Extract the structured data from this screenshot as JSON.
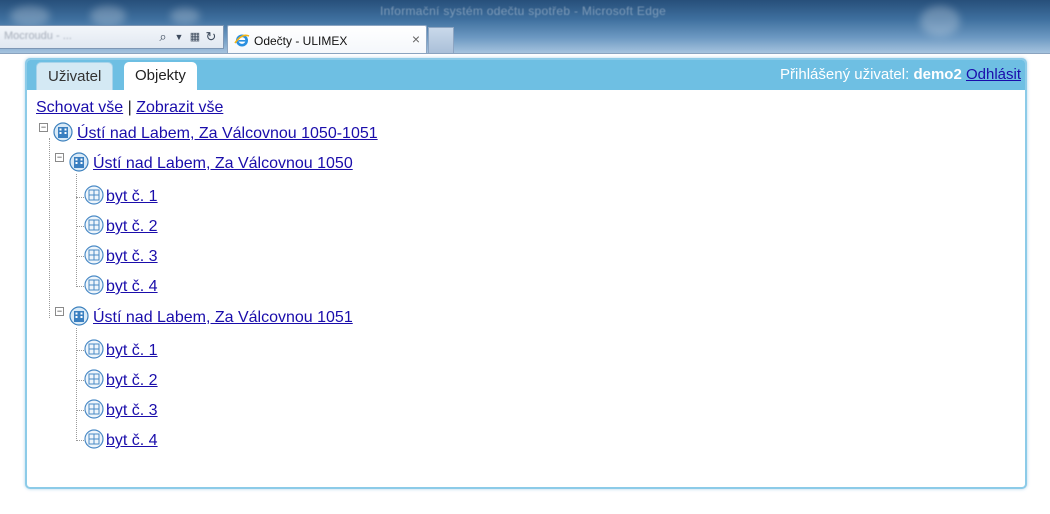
{
  "browser": {
    "window_title": "Informační systém odečtu spotřeb - Microsoft Edge",
    "address_text": "Mocroudu - ...",
    "tab_title": "Odečty - ULIMEX",
    "tab_close": "×"
  },
  "tabs": [
    {
      "label": "Uživatel",
      "active": false
    },
    {
      "label": "Objekty",
      "active": true
    }
  ],
  "user": {
    "prefix": "Přihlášený uživatel: ",
    "name": "demo2",
    "logout": "Odhlásit"
  },
  "controls": {
    "hide_all": "Schovat vše",
    "separator": " | ",
    "show_all": "Zobrazit vše"
  },
  "tree": {
    "root": {
      "label": "Ústí nad Labem, Za Válcovnou 1050-1051",
      "expanded": true,
      "children": [
        {
          "label": "Ústí nad Labem, Za Válcovnou 1050",
          "expanded": true,
          "children": [
            {
              "label": "byt č. 1"
            },
            {
              "label": "byt č. 2"
            },
            {
              "label": "byt č. 3"
            },
            {
              "label": "byt č. 4"
            }
          ]
        },
        {
          "label": "Ústí nad Labem, Za Válcovnou 1051",
          "expanded": true,
          "children": [
            {
              "label": "byt č. 1"
            },
            {
              "label": "byt č. 2"
            },
            {
              "label": "byt č. 3"
            },
            {
              "label": "byt č. 4"
            }
          ]
        }
      ]
    }
  },
  "icons": {
    "toggle": "minus-icon",
    "building": "building-icon",
    "apartment": "apartment-icon",
    "browser": "ie-icon"
  },
  "colors": {
    "tabbar": "#6ebfe3",
    "link": "#1a0dab",
    "panel_border": "#8ccbe8"
  }
}
